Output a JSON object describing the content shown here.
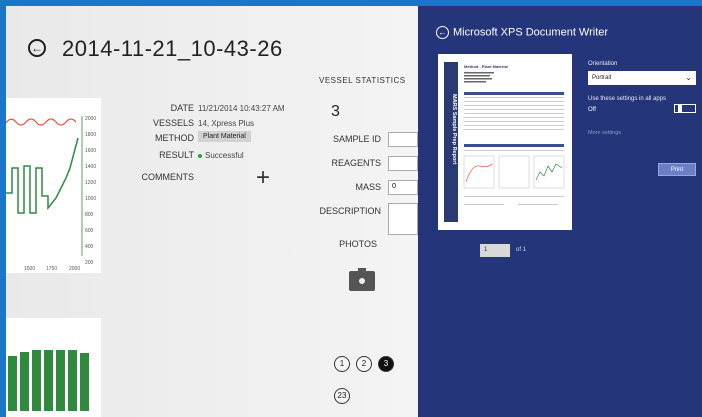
{
  "header": {
    "title": "2014-11-21_10-43-26"
  },
  "chart_top": {
    "ytick_labels": [
      "2000",
      "1800",
      "1600",
      "1400",
      "1200",
      "1000",
      "800",
      "600",
      "400",
      "200"
    ],
    "xtick_labels": [
      "1500",
      "1750",
      "2000"
    ]
  },
  "details": {
    "date_label": "DATE",
    "date_value": "11/21/2014 10:43:27 AM",
    "vessels_label": "VESSELS",
    "vessels_value": "14, Xpress Plus",
    "method_label": "METHOD",
    "method_value": "Plant Material",
    "result_label": "RESULT",
    "result_value": "Successful",
    "comments_label": "COMMENTS",
    "add_symbol": "+"
  },
  "vessel_stats": {
    "title": "VESSEL STATISTICS",
    "number": "3",
    "sample_id_label": "SAMPLE ID",
    "reagents_label": "REAGENTS",
    "mass_label": "MASS",
    "mass_value": "0",
    "description_label": "DESCRIPTION",
    "photos_label": "PHOTOS"
  },
  "pager": {
    "pages": [
      "1",
      "2",
      "3"
    ],
    "active": "3",
    "bottom": "23"
  },
  "print_panel": {
    "title": "Microsoft XPS Document Writer",
    "orientation_label": "Orientation",
    "orientation_value": "Portrait",
    "use_settings_label": "Use these settings in all apps",
    "use_settings_value": "Off",
    "more_settings": "More settings",
    "print_button": "Print",
    "page_number": "1",
    "page_of": "of 1",
    "preview_title": "Method - Plant Material",
    "preview_banner": "MARS Sample Prep Report"
  },
  "colors": {
    "accent_blue": "#1976c9",
    "panel_navy": "#25357a",
    "chart_green": "#2e8b3e",
    "chart_red": "#e8563a"
  }
}
